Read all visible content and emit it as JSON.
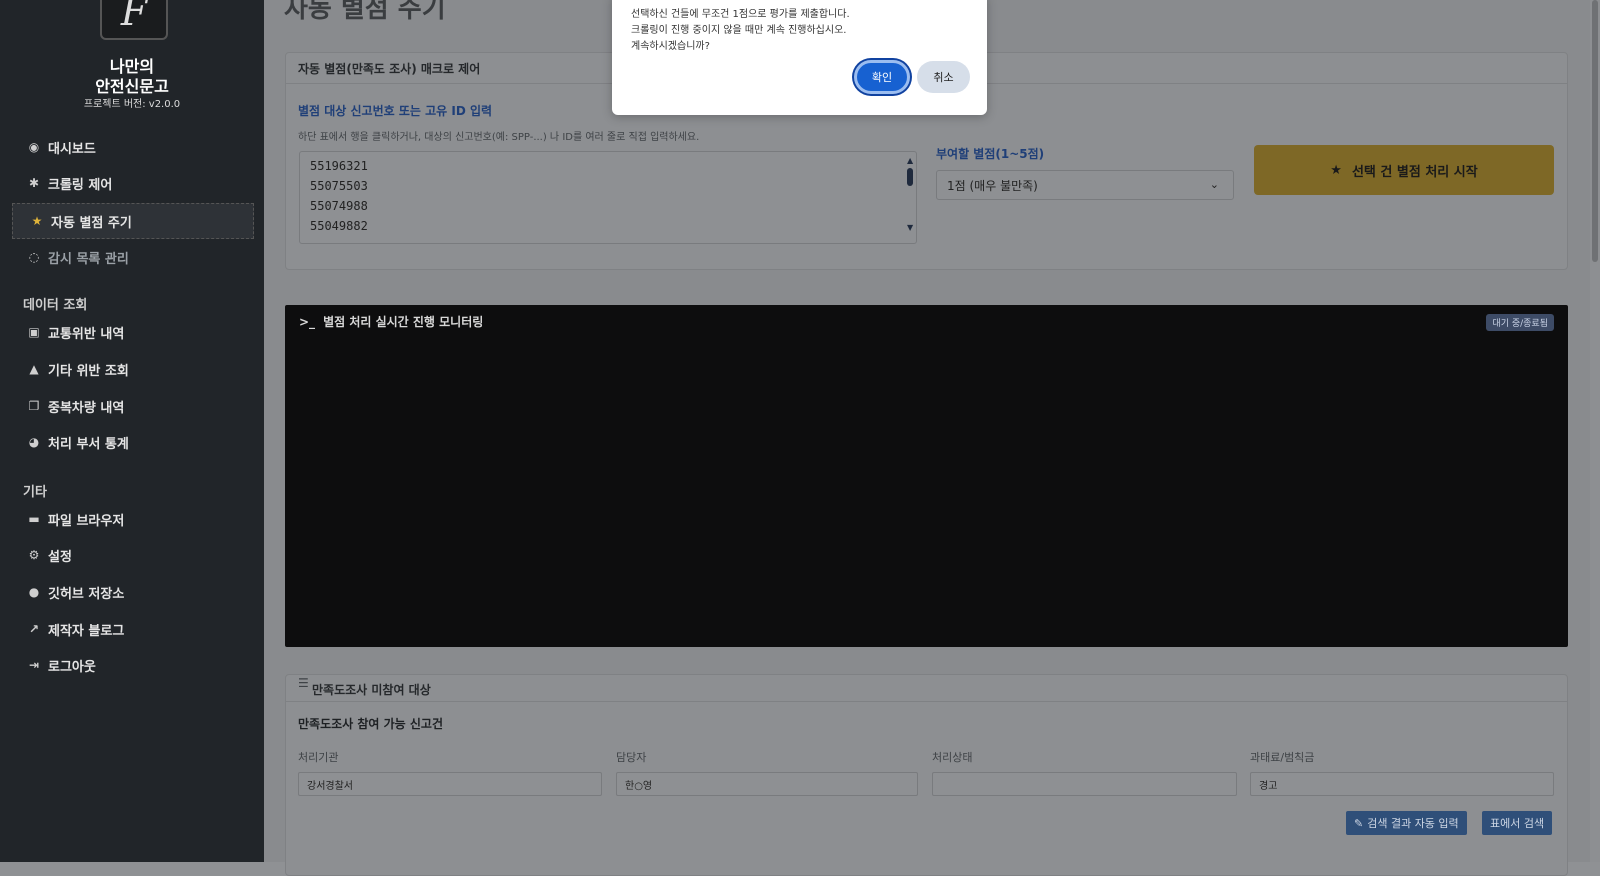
{
  "sidebar": {
    "logo_glyph": "F",
    "brand_line1": "나만의",
    "brand_line2": "안전신문고",
    "version": "프로젝트 버전: v2.0.0",
    "items": [
      {
        "label": "대시보드",
        "icon": "gauge-icon"
      },
      {
        "label": "크롤링 제어",
        "icon": "bug-icon"
      },
      {
        "label": "자동 별점 주기",
        "icon": "star-icon"
      },
      {
        "label": "감시 목록 관리",
        "icon": "eye-icon"
      }
    ],
    "section_data": "데이터 조회",
    "data_items": [
      {
        "label": "교통위반 내역",
        "icon": "car-icon"
      },
      {
        "label": "기타 위반 조회",
        "icon": "warning-icon"
      },
      {
        "label": "중복차량 내역",
        "icon": "copy-icon"
      },
      {
        "label": "처리 부서 통계",
        "icon": "pie-chart-icon"
      }
    ],
    "section_etc": "기타",
    "etc_items": [
      {
        "label": "파일 브라우저",
        "icon": "folder-icon"
      },
      {
        "label": "설정",
        "icon": "gear-icon"
      },
      {
        "label": "깃허브 저장소",
        "icon": "github-icon"
      },
      {
        "label": "제작자 블로그",
        "icon": "external-link-icon"
      },
      {
        "label": "로그아웃",
        "icon": "logout-icon"
      }
    ]
  },
  "page": {
    "title": "자동 별점 주기",
    "macro_card": {
      "header": "자동 별점(만족도 조사) 매크로 제어",
      "id_label": "별점 대상 신고번호 또는 고유 ID 입력",
      "id_help": "하단 표에서 행을 클릭하거나, 대상의 신고번호(예: SPP-...) 나 ID를 여러 줄로 직접 입력하세요.",
      "ids": [
        "55196321",
        "55075503",
        "55074988",
        "55049882"
      ],
      "score_label": "부여할 별점(1~5점)",
      "score_selected": "1점 (매우 불만족)",
      "start_button": "선택 건 별점 처리 시작"
    },
    "terminal": {
      "title": "별점 처리 실시간 진행 모니터링",
      "badge": "대기 중/종료됨"
    },
    "survey_card": {
      "header": "만족도조사 미참여 대상",
      "subheader": "만족도조사 참여 가능 신고건",
      "fields": [
        {
          "label": "처리기관",
          "value": "강서경찰서"
        },
        {
          "label": "담당자",
          "value": "한○영"
        },
        {
          "label": "처리상태",
          "value": ""
        },
        {
          "label": "과태료/범칙금",
          "value": "경고"
        }
      ],
      "btn_auto_fill": "검색 결과 자동 입력",
      "btn_search": "표에서 검색"
    }
  },
  "dialog": {
    "message_lines": [
      "선택하신 건들에 무조건 1점으로 평가를 제출합니다.",
      "크롤링이 진행 중이지 않을 때만 계속 진행하십시오.",
      "계속하시겠습니까?"
    ],
    "ok_label": "확인",
    "cancel_label": "취소"
  }
}
